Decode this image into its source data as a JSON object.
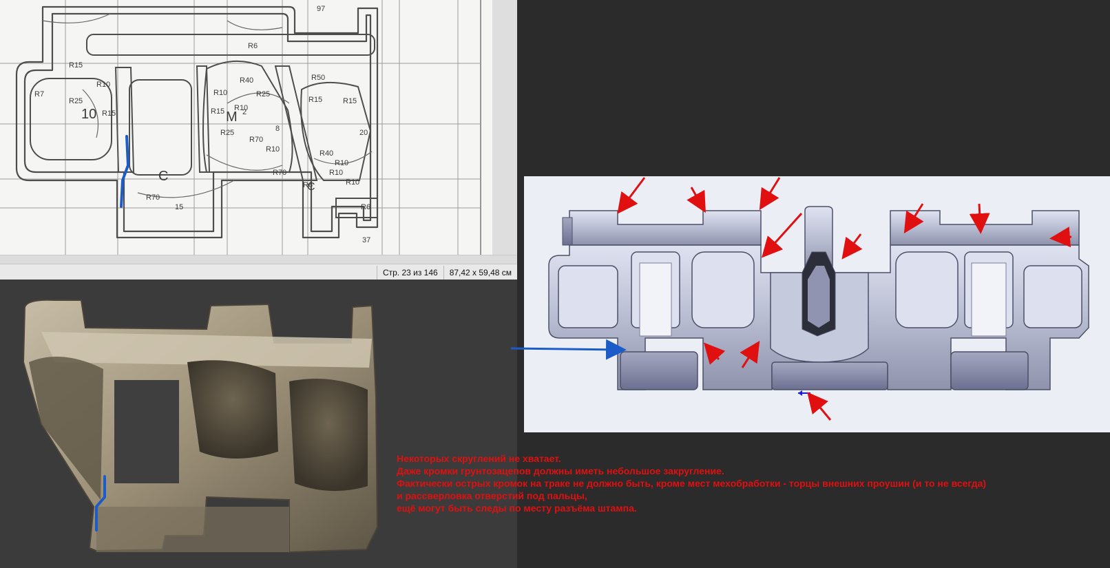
{
  "pdf_viewer": {
    "page_indicator": "Стр. 23 из 146",
    "page_size": "87,42 x 59,48 см"
  },
  "comment": {
    "lines": [
      "Некоторых скруглений не хватает.",
      "Даже кромки грунтозацепов должны иметь небольшое закругление.",
      "Фактически острых кромок на траке не должно быть, кроме мест мехобработки - торцы внешних проушин (и то не всегда)",
      "и рассверловка отверстий под пальцы,",
      "ещё могут быть следы по месту разъёма штампа."
    ]
  },
  "drawing_labels": {
    "dims": [
      "97",
      "R6",
      "R15",
      "R10",
      "R7",
      "R25",
      "10",
      "R15",
      "R10",
      "R40",
      "R25",
      "R15",
      "R10",
      "R50",
      "R15",
      "R25",
      "R15",
      "R70",
      "R10",
      "R40",
      "R70",
      "R6",
      "R10",
      "R10",
      "R70",
      "15",
      "R6",
      "37",
      "C",
      "C",
      "M",
      "2",
      "8",
      "20",
      "R10"
    ]
  },
  "colors": {
    "annotation_red": "#e01010",
    "marker_blue": "#1c5cc8",
    "drawing_ink": "#555555"
  }
}
